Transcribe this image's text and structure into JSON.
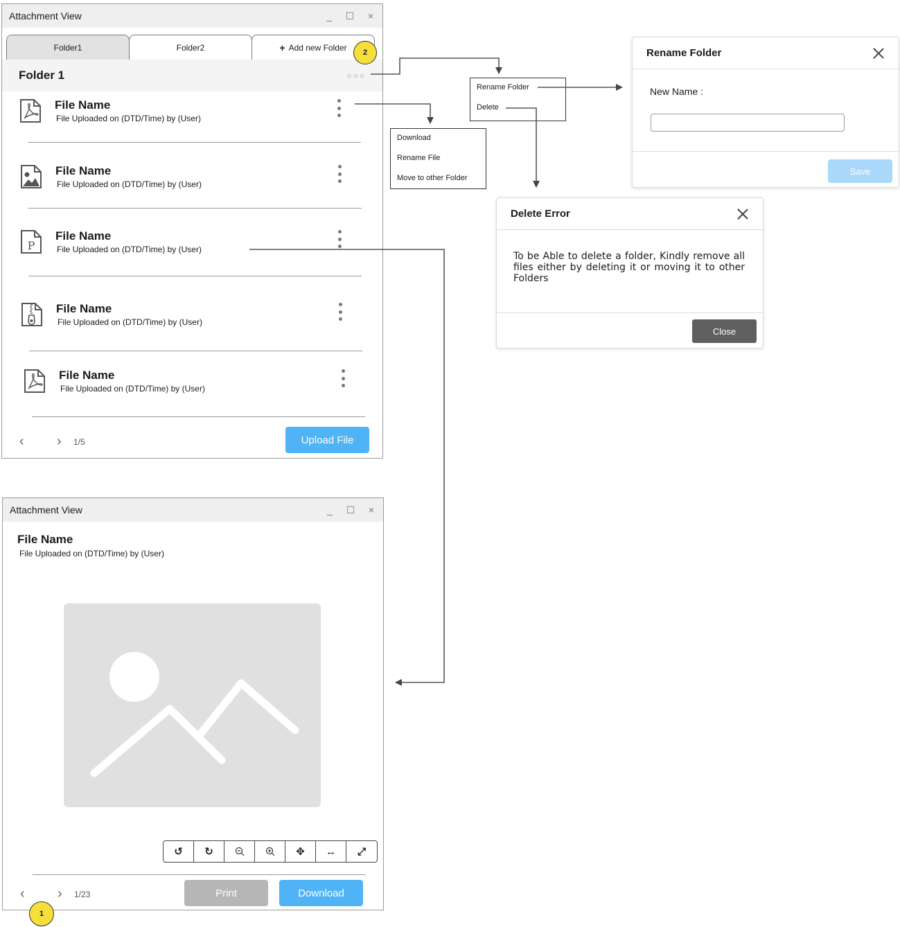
{
  "window1": {
    "title": "Attachment View",
    "controls": {
      "minimize": "_",
      "maximize": "☐",
      "close": "×"
    },
    "tabs": [
      {
        "label": "Folder1"
      },
      {
        "label": "Folder2"
      },
      {
        "label": "Add new Folder"
      }
    ],
    "add_tab_icon": "+",
    "badge": "2",
    "folder_title": "Folder 1",
    "folder_menu_dots": "○○○",
    "files": [
      {
        "name": "File Name",
        "meta": "File Uploaded on (DTD/Time) by (User)",
        "icon": "pdf-file-icon"
      },
      {
        "name": "File Name",
        "meta": "File Uploaded on (DTD/Time) by (User)",
        "icon": "image-file-icon"
      },
      {
        "name": "File Name",
        "meta": "File Uploaded on (DTD/Time) by (User)",
        "icon": "ppt-file-icon"
      },
      {
        "name": "File Name",
        "meta": "File Uploaded on (DTD/Time) by (User)",
        "icon": "zip-file-icon"
      },
      {
        "name": "File Name",
        "meta": "File Uploaded on (DTD/Time) by (User)",
        "icon": "pdf-file-icon"
      }
    ],
    "pager": {
      "prev": "‹",
      "next": "›",
      "text": "1/5"
    },
    "upload_label": "Upload File"
  },
  "file_menu": {
    "items": [
      "Download",
      "Rename File",
      "Move to other Folder"
    ]
  },
  "folder_menu": {
    "items": [
      "Rename Folder",
      "Delete"
    ]
  },
  "rename_dialog": {
    "title": "Rename Folder",
    "field_label": "New Name :",
    "field_value": "",
    "save_label": "Save"
  },
  "delete_dialog": {
    "title": "Delete Error",
    "message": "To be Able to delete a folder, Kindly remove all files either by deleting it or moving it to other Folders",
    "close_label": "Close"
  },
  "window2": {
    "title": "Attachment View",
    "controls": {
      "minimize": "_",
      "maximize": "☐",
      "close": "×"
    },
    "file_name": "File Name",
    "file_meta": "File Uploaded on (DTD/Time) by (User)",
    "toolbar": [
      {
        "icon": "rotate-left-icon",
        "glyph": "↺"
      },
      {
        "icon": "rotate-right-icon",
        "glyph": "↻"
      },
      {
        "icon": "zoom-out-icon",
        "glyph": "−"
      },
      {
        "icon": "zoom-in-icon",
        "glyph": "+"
      },
      {
        "icon": "move-icon",
        "glyph": "✥"
      },
      {
        "icon": "fit-width-icon",
        "glyph": "↔"
      },
      {
        "icon": "fullscreen-icon",
        "glyph": "⤢"
      }
    ],
    "pager": {
      "prev": "‹",
      "next": "›",
      "text": "1/23"
    },
    "print_label": "Print",
    "download_label": "Download",
    "badge": "1"
  },
  "colors": {
    "accent": "#4fb3f5",
    "badge": "#f6df3b",
    "disabled": "#b6b6b6",
    "close_button": "#5f5f5f",
    "save_button": "#a9d8fb"
  }
}
